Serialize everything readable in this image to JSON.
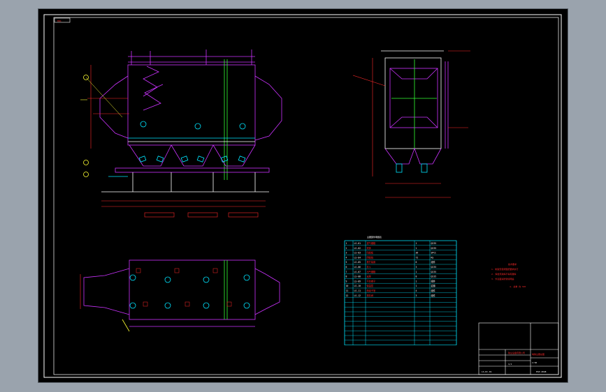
{
  "drawing": {
    "frame_tag": "DWG",
    "title_text": "ESP-2048",
    "drawing_number": "LS-DC-01",
    "note_heading": "技术要求",
    "note_lines": [
      "1. 制造安装按图纸要求执行",
      "2. 焊缝须满焊不得有漏焊",
      "3. 外表面涂防锈漆两遍",
      "4. 总重 约 58t"
    ],
    "bom_heading": "主要部件明细表",
    "bom_rows": [
      [
        "1",
        "LS-01",
        "进气烟箱",
        "1",
        "Q235"
      ],
      [
        "2",
        "LS-02",
        "壳体",
        "1",
        "Q235"
      ],
      [
        "3",
        "LS-03",
        "阳极板",
        "36",
        "SPCC"
      ],
      [
        "4",
        "LS-04",
        "阴极线",
        "72",
        "RS"
      ],
      [
        "5",
        "LS-05",
        "振打装置",
        "6",
        "组件"
      ],
      [
        "6",
        "LS-06",
        "灰斗",
        "3",
        "Q235"
      ],
      [
        "7",
        "LS-07",
        "出气烟箱",
        "1",
        "Q235"
      ],
      [
        "8",
        "LS-08",
        "支座",
        "8",
        "Q235"
      ],
      [
        "9",
        "LS-09",
        "平台梯子",
        "1",
        "组件"
      ],
      [
        "10",
        "LS-10",
        "保温层",
        "1",
        "岩棉"
      ],
      [
        "11",
        "LS-11",
        "绝缘子室",
        "4",
        "组件"
      ],
      [
        "12",
        "LS-12",
        "排灰阀",
        "3",
        "组件"
      ]
    ],
    "title_block": {
      "company": "除尘设备有限公司",
      "name": "电除尘器总图",
      "scale": "1:50",
      "sheet": "1/1"
    },
    "colors": {
      "cad_bg": "#000000",
      "frame": "#ffffff",
      "structure": "#cc33ff",
      "cyan": "#00e5ff",
      "green": "#33ff33",
      "yellow": "#ffff33",
      "red": "#ff2a2a"
    }
  }
}
